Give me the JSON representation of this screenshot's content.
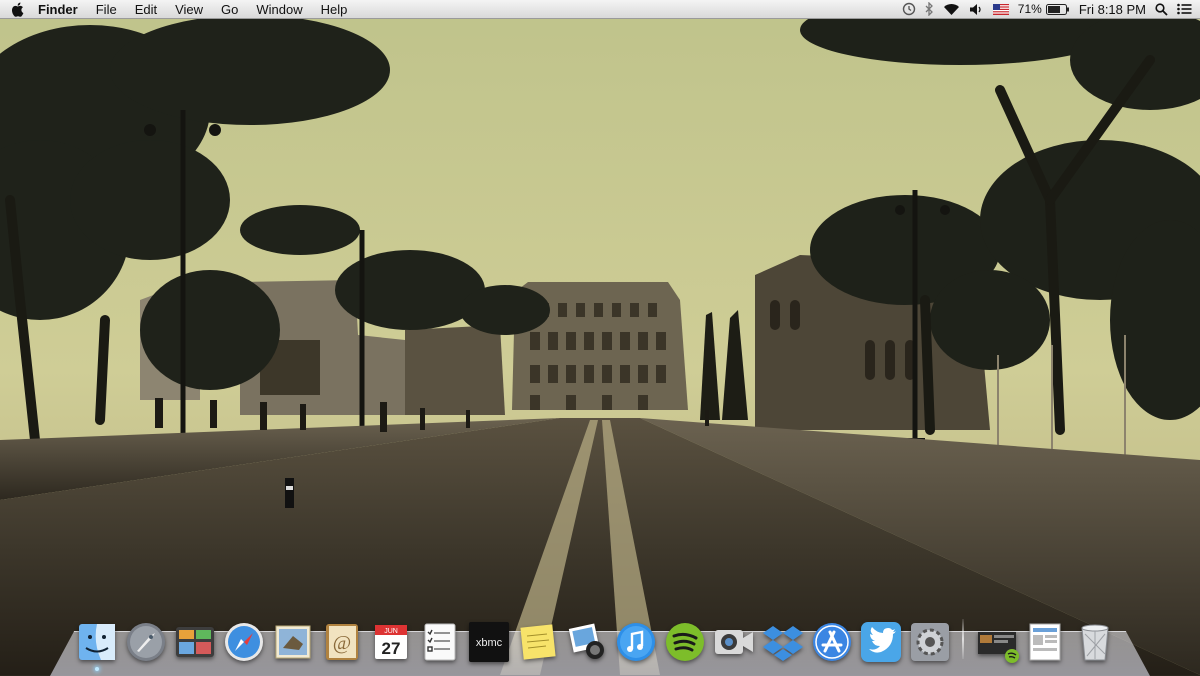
{
  "menubar": {
    "app_name": "Finder",
    "menus": [
      "File",
      "Edit",
      "View",
      "Go",
      "Window",
      "Help"
    ],
    "battery_percent": "71%",
    "clock": "Fri 8:18 PM",
    "status_icons": [
      "time-machine-icon",
      "bluetooth-icon",
      "wifi-icon",
      "volume-icon",
      "us-flag-icon",
      "battery-icon",
      "spotlight-icon",
      "notification-center-icon"
    ]
  },
  "desktop": {
    "wallpaper": "sepia city street with ancient ruins and colosseum"
  },
  "dock": {
    "apps": [
      {
        "name": "finder",
        "running": true
      },
      {
        "name": "launchpad",
        "running": false
      },
      {
        "name": "mission-control",
        "running": false
      },
      {
        "name": "safari",
        "running": false
      },
      {
        "name": "mail",
        "running": false
      },
      {
        "name": "contacts",
        "running": false
      },
      {
        "name": "calendar",
        "running": false
      },
      {
        "name": "reminders",
        "running": false
      },
      {
        "name": "xbmc",
        "running": false
      },
      {
        "name": "stickies",
        "running": false
      },
      {
        "name": "iphoto",
        "running": false
      },
      {
        "name": "itunes",
        "running": false
      },
      {
        "name": "spotify",
        "running": false
      },
      {
        "name": "facetime",
        "running": false
      },
      {
        "name": "dropbox",
        "running": false
      },
      {
        "name": "app-store",
        "running": false
      },
      {
        "name": "twitter",
        "running": false
      },
      {
        "name": "system-preferences",
        "running": false
      }
    ],
    "calendar_month": "JUN",
    "calendar_day": "27",
    "xbmc_label": "xbmc",
    "stacks": [
      "minimized-window",
      "documents-stack",
      "trash"
    ]
  },
  "colors": {
    "sky": "#c9c98f",
    "menubar": "#e6e6e6",
    "accent": "#2f7fe0"
  }
}
